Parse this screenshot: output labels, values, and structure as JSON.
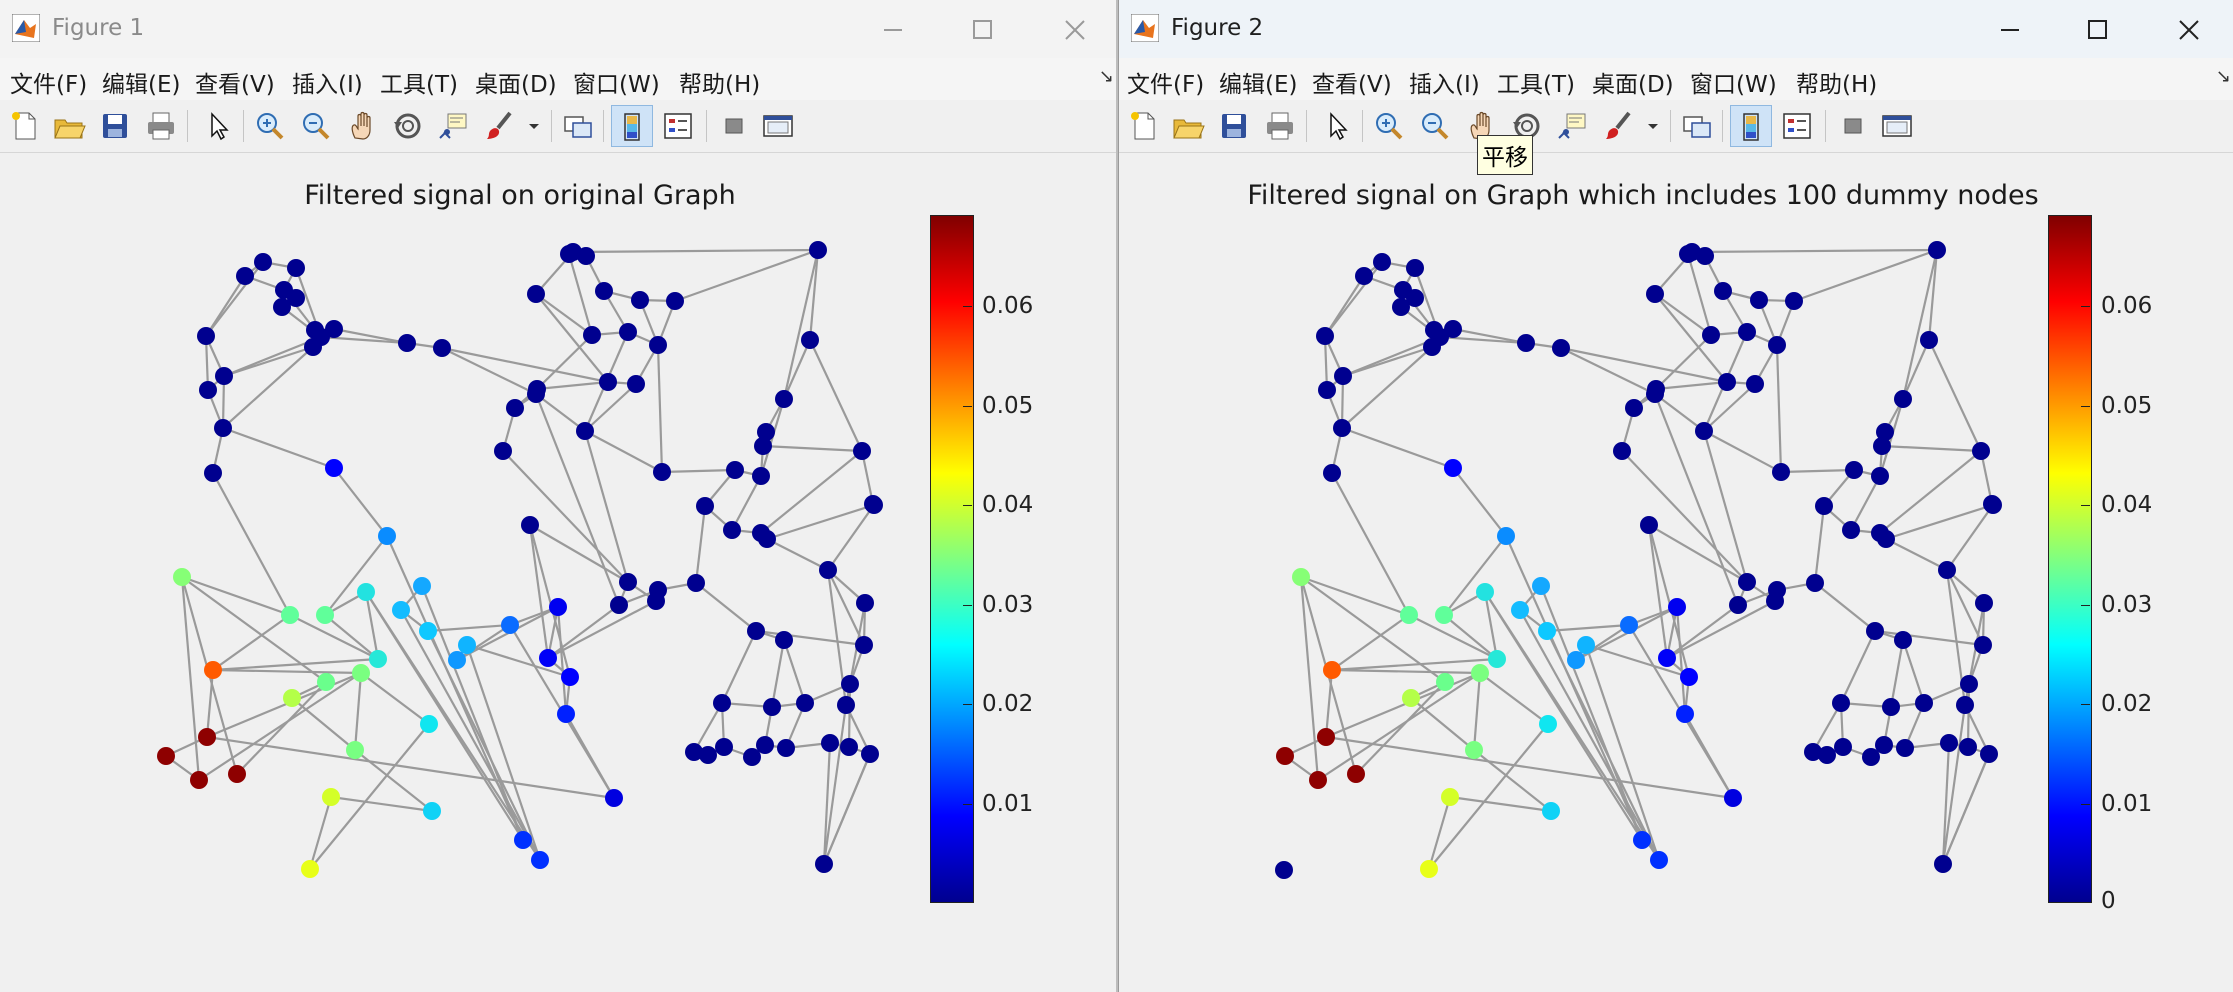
{
  "figure1": {
    "title": "Figure 1",
    "menu": [
      "文件(F)",
      "编辑(E)",
      "查看(V)",
      "插入(I)",
      "工具(T)",
      "桌面(D)",
      "窗口(W)",
      "帮助(H)"
    ],
    "axes_title": "Filtered signal on original Graph",
    "colorbar_ticks": [
      "0.01",
      "0.02",
      "0.03",
      "0.04",
      "0.05",
      "0.06"
    ]
  },
  "figure2": {
    "title": "Figure 2",
    "menu": [
      "文件(F)",
      "编辑(E)",
      "查看(V)",
      "插入(I)",
      "工具(T)",
      "桌面(D)",
      "窗口(W)",
      "帮助(H)"
    ],
    "axes_title": "Filtered signal on Graph which includes 100 dummy nodes",
    "colorbar_ticks": [
      "0",
      "0.01",
      "0.02",
      "0.03",
      "0.04",
      "0.05",
      "0.06"
    ],
    "tooltip": "平移"
  },
  "toolbar_icons": [
    "new-file-icon",
    "open-folder-icon",
    "save-icon",
    "print-icon",
    "pointer-icon",
    "zoom-in-icon",
    "zoom-out-icon",
    "pan-icon",
    "rotate-3d-icon",
    "data-cursor-icon",
    "brush-icon",
    "link-plot-icon",
    "colorbar-icon",
    "legend-icon",
    "hide-plot-tools-icon",
    "show-plot-tools-icon"
  ],
  "colormap": "jet",
  "colorbar_range": [
    0,
    0.069
  ]
}
